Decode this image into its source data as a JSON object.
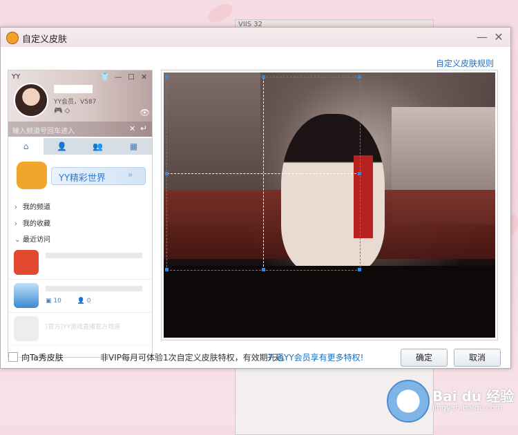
{
  "dialog": {
    "title": "自定义皮肤",
    "minimize_glyph": "—",
    "close_glyph": "✕",
    "rules_link": "自定义皮肤规则"
  },
  "preview": {
    "app_label": "YY",
    "vip_text": "YY会员，V587",
    "search_placeholder": "输入频道号回车进入",
    "nav": [
      {
        "label": "我的频道",
        "expanded": false
      },
      {
        "label": "我的收藏",
        "expanded": false
      },
      {
        "label": "最近访问",
        "expanded": true
      }
    ],
    "banner_label": "YY精彩世界",
    "recent": [
      {
        "meta_a": "",
        "meta_b": ""
      },
      {
        "meta_a": "10",
        "meta_b": "0"
      },
      {
        "faded_title": "[官方]YY游戏直播官方频道"
      }
    ]
  },
  "footer": {
    "checkbox_label": "向Ta秀皮肤",
    "checkbox_checked": false,
    "notice": "非VIP每月可体验1次自定义皮肤特权，有效期7天。",
    "vip_link": "开通YY会员享有更多特权!",
    "confirm": "确定",
    "cancel": "取消"
  },
  "background_window": {
    "title": "VIIS 32"
  },
  "watermark": {
    "brand": "Bai du 经验",
    "url": "jingyan.baidu.com"
  },
  "colors": {
    "accent": "#2f8ae0",
    "link": "#1a6fc2"
  }
}
